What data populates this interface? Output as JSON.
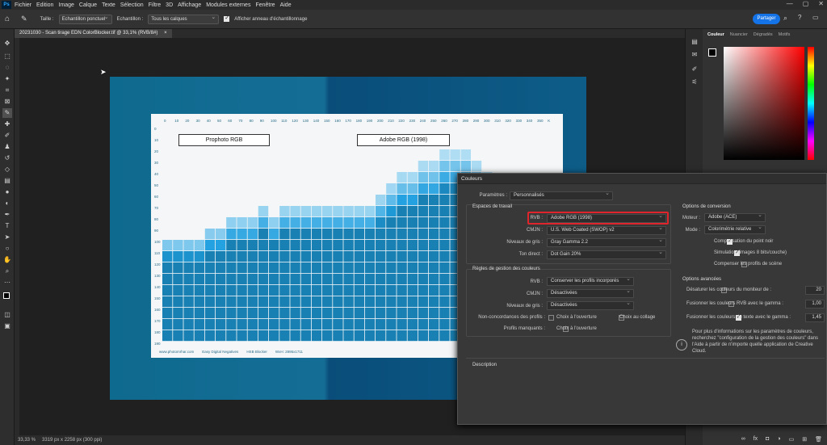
{
  "menubar": {
    "logo": "Ps",
    "items": [
      "Fichier",
      "Edition",
      "Image",
      "Calque",
      "Texte",
      "Sélection",
      "Filtre",
      "3D",
      "Affichage",
      "Modules externes",
      "Fenêtre",
      "Aide"
    ],
    "controls": [
      "—",
      "▢",
      "✕"
    ]
  },
  "options": {
    "size_label": "Taille :",
    "size_value": "Echantillon ponctuel",
    "sample_label": "Echantillon :",
    "sample_value": "Tous les calques",
    "ring_label": "Afficher anneau d'échantillonnage",
    "share": "Partager"
  },
  "document": {
    "tab_title": "20231030 - Scan tirage EDN ColorBlocker.tif @ 33,1% (RVB/8#)",
    "zoom": "33,33 %",
    "info": "3319 px x 2258 px (300 ppi)"
  },
  "chart_image": {
    "top_ticks": [
      "0",
      "10",
      "20",
      "30",
      "40",
      "50",
      "60",
      "70",
      "80",
      "90",
      "100",
      "110",
      "120",
      "130",
      "140",
      "150",
      "160",
      "170",
      "180",
      "190",
      "200",
      "210",
      "220",
      "230",
      "240",
      "250",
      "260",
      "270",
      "280",
      "290",
      "300",
      "310",
      "320",
      "330",
      "340",
      "350",
      "K"
    ],
    "left_ticks": [
      "0",
      "10",
      "20",
      "30",
      "40",
      "50",
      "60",
      "70",
      "80",
      "90",
      "100",
      "110",
      "120",
      "130",
      "140",
      "150",
      "160",
      "170",
      "180",
      "190"
    ],
    "label_left": "Prophoto RGB",
    "label_right": "Adobe RGB (1998)",
    "footer": [
      "www.photomrhar.com",
      "Easy Digital Negatives",
      "HSB Blocker",
      "WxH: 2895x1711"
    ]
  },
  "right_panel": {
    "tabs": [
      "Couleur",
      "Nuancier",
      "Dégradés",
      "Motifs"
    ],
    "accent": "#1473e6"
  },
  "dialog": {
    "title": "Couleurs",
    "params_label": "Paramètres :",
    "params_value": "Personnalisés",
    "work_spaces": "Espaces de travail",
    "rvb_label": "RVB :",
    "rvb_value": "Adobe RGB (1998)",
    "cmjn_label": "CMJN :",
    "cmjn_value": "U.S. Web Coated (SWOP) v2",
    "gray_label": "Niveaux de gris :",
    "gray_value": "Gray Gamma 2.2",
    "spot_label": "Ton direct :",
    "spot_value": "Dot Gain 20%",
    "rules_title": "Règles de gestion des couleurs",
    "r_rvb_label": "RVB :",
    "r_rvb_value": "Conserver les profils incorporés",
    "r_cmjn_label": "CMJN :",
    "r_cmjn_value": "Désactivées",
    "r_gray_label": "Niveaux de gris :",
    "r_gray_value": "Désactivées",
    "mismatch_label": "Non-concordances des profils :",
    "mismatch_open": "Choix à l'ouverture",
    "mismatch_paste": "Choix au collage",
    "missing_label": "Profils manquants :",
    "missing_open": "Choix à l'ouverture",
    "conv_title": "Options de conversion",
    "engine_label": "Moteur :",
    "engine_value": "Adobe (ACE)",
    "mode_label": "Mode :",
    "mode_value": "Colorimétrie relative",
    "bpc": "Compensation du point noir",
    "dither": "Simulation (images 8 bits/couche)",
    "scene": "Compenser les profils de scène",
    "adv_title": "Options avancées",
    "desat": "Désaturer les couleurs du moniteur de :",
    "desat_val": "20",
    "blend_rgb": "Fusionner les couleurs RVB avec le gamma :",
    "blend_rgb_val": "1,00",
    "blend_text": "Fusionner les couleurs du texte avec le gamma :",
    "blend_text_val": "1,45",
    "info": "Pour plus d'informations sur les paramètres de couleurs, recherchez \"configuration de la gestion des couleurs\" dans l'Aide à partir de n'importe quelle application de Creative Cloud.",
    "desc_title": "Description",
    "highlight_color": "#e0242b"
  }
}
